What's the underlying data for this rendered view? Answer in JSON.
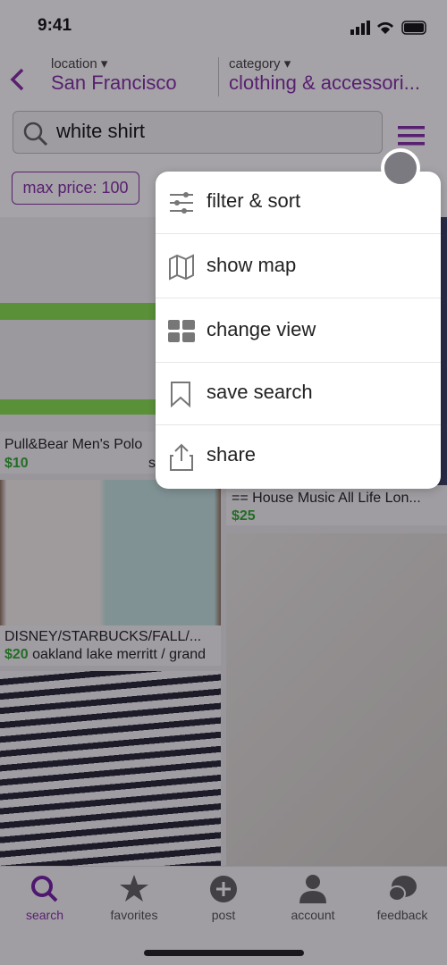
{
  "status": {
    "time": "9:41"
  },
  "header": {
    "location_label": "location ▾",
    "location_value": "San Francisco",
    "category_label": "category ▾",
    "category_value": "clothing & accessori..."
  },
  "search": {
    "value": "white shirt",
    "icon": "search-icon",
    "menu_icon": "hamburger-icon"
  },
  "filters": {
    "chip": "max price: 100"
  },
  "listings": [
    {
      "title": "Pull&Bear Men's Polo",
      "price": "$10",
      "location": "s"
    },
    {
      "title": "== House Music All Life Lon...",
      "price": "$25",
      "location": ""
    },
    {
      "title": "DISNEY/STARBUCKS/FALL/...",
      "price": "$20",
      "location": "oakland lake merritt / grand"
    }
  ],
  "menu": {
    "items": [
      {
        "label": "filter & sort",
        "icon": "sliders-icon"
      },
      {
        "label": "show map",
        "icon": "map-icon"
      },
      {
        "label": "change view",
        "icon": "grid-icon"
      },
      {
        "label": "save search",
        "icon": "bookmark-icon"
      },
      {
        "label": "share",
        "icon": "share-icon"
      }
    ]
  },
  "tabs": [
    {
      "label": "search",
      "icon": "search-icon",
      "active": true
    },
    {
      "label": "favorites",
      "icon": "star-icon"
    },
    {
      "label": "post",
      "icon": "plus-circle-icon"
    },
    {
      "label": "account",
      "icon": "person-icon"
    },
    {
      "label": "feedback",
      "icon": "chat-bubbles-icon"
    }
  ],
  "colors": {
    "accent": "#7a1ea1",
    "price": "#22a322"
  }
}
